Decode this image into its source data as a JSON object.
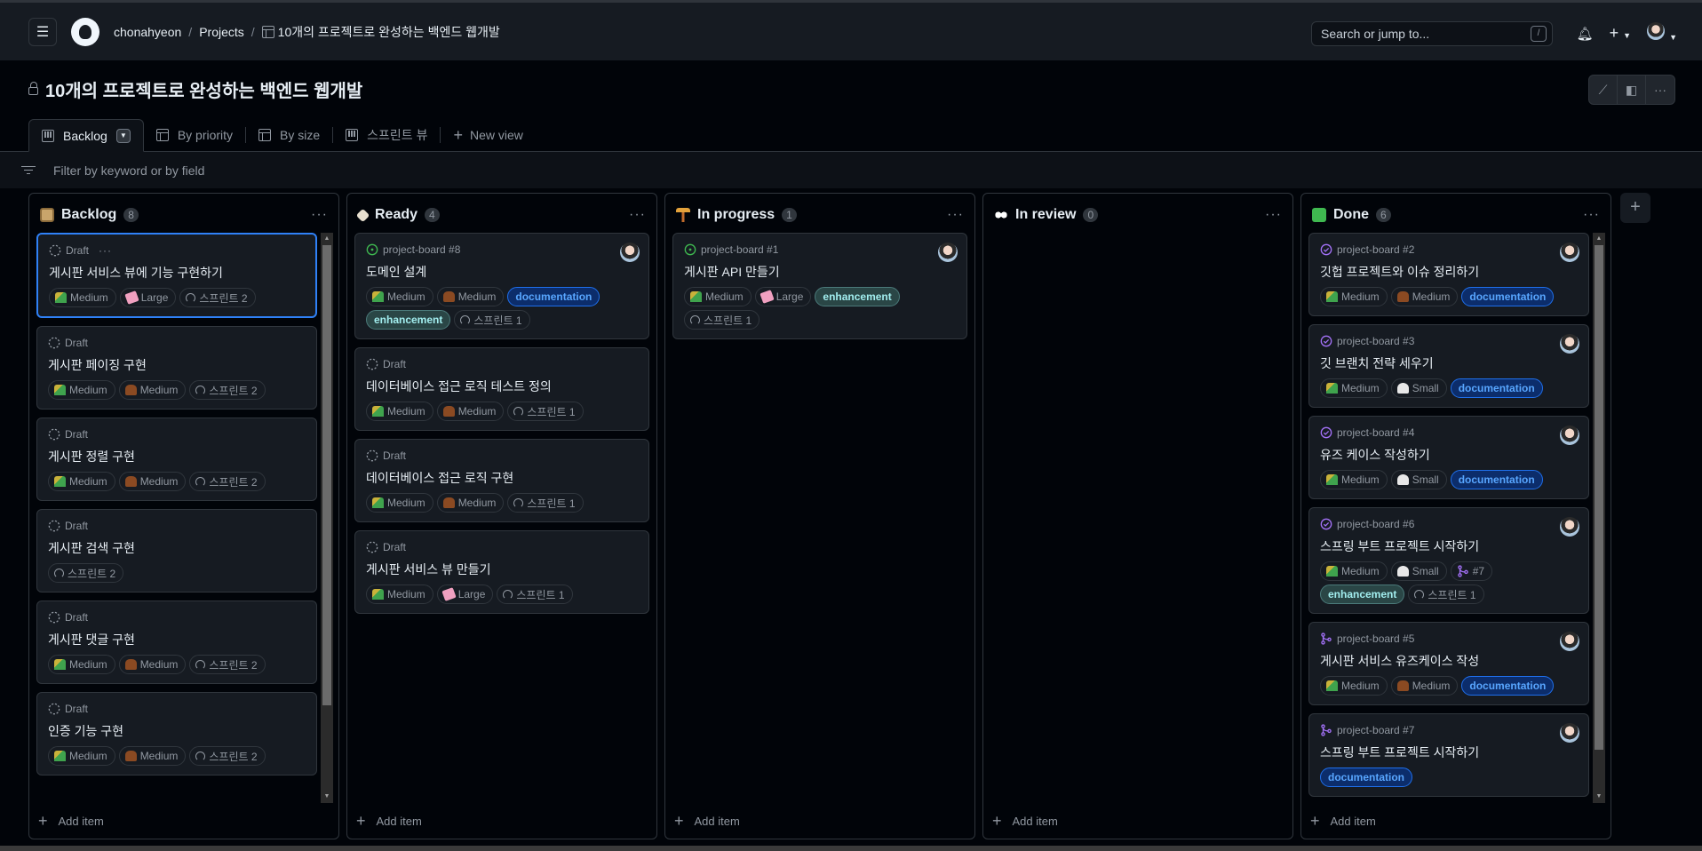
{
  "header": {
    "user": "chonahyeon",
    "projects_link": "Projects",
    "project_name": "10개의 프로젝트로 완성하는 백엔드 웹개발",
    "search_placeholder": "Search or jump to...",
    "search_shortcut": "/"
  },
  "page": {
    "title": "10개의 프로젝트로 완성하는 백엔드 웹개발",
    "visibility_icon": "lock-icon"
  },
  "views": [
    {
      "label": "Backlog",
      "icon": "board",
      "active": true
    },
    {
      "label": "By priority",
      "icon": "table",
      "active": false
    },
    {
      "label": "By size",
      "icon": "table",
      "active": false
    },
    {
      "label": "스프린트 뷰",
      "icon": "board",
      "active": false
    }
  ],
  "new_view_label": "New view",
  "filter_placeholder": "Filter by keyword or by field",
  "add_item_label": "Add item",
  "colors": {
    "accent": "#2f81f7",
    "open": "#3fb950",
    "done": "#a371f7"
  },
  "columns": [
    {
      "name": "Backlog",
      "count": "8",
      "icon": "clipboard",
      "scroll": true,
      "cards": [
        {
          "status": "draft",
          "ref": "Draft",
          "selected": true,
          "title": "게시판 서비스 뷰에 기능 구현하기",
          "chips": [
            {
              "type": "priority",
              "text": "Medium"
            },
            {
              "type": "size-large",
              "text": "Large"
            },
            {
              "type": "iteration",
              "text": "스프린트 2"
            }
          ]
        },
        {
          "status": "draft",
          "ref": "Draft",
          "title": "게시판 페이징 구현",
          "chips": [
            {
              "type": "priority",
              "text": "Medium"
            },
            {
              "type": "size-medium",
              "text": "Medium"
            },
            {
              "type": "iteration",
              "text": "스프린트 2"
            }
          ]
        },
        {
          "status": "draft",
          "ref": "Draft",
          "title": "게시판 정렬 구현",
          "chips": [
            {
              "type": "priority",
              "text": "Medium"
            },
            {
              "type": "size-medium",
              "text": "Medium"
            },
            {
              "type": "iteration",
              "text": "스프린트 2"
            }
          ]
        },
        {
          "status": "draft",
          "ref": "Draft",
          "title": "게시판 검색 구현",
          "chips": [
            {
              "type": "iteration",
              "text": "스프린트 2"
            }
          ]
        },
        {
          "status": "draft",
          "ref": "Draft",
          "title": "게시판 댓글 구현",
          "chips": [
            {
              "type": "priority",
              "text": "Medium"
            },
            {
              "type": "size-medium",
              "text": "Medium"
            },
            {
              "type": "iteration",
              "text": "스프린트 2"
            }
          ]
        },
        {
          "status": "draft",
          "ref": "Draft",
          "title": "인증 기능 구현",
          "chips": [
            {
              "type": "priority",
              "text": "Medium"
            },
            {
              "type": "size-medium",
              "text": "Medium"
            },
            {
              "type": "iteration",
              "text": "스프린트 2"
            }
          ]
        }
      ]
    },
    {
      "name": "Ready",
      "count": "4",
      "icon": "tag",
      "cards": [
        {
          "status": "open",
          "ref": "project-board #8",
          "avatar": true,
          "title": "도메인 설계",
          "chips": [
            {
              "type": "priority",
              "text": "Medium"
            },
            {
              "type": "size-medium",
              "text": "Medium"
            },
            {
              "type": "documentation",
              "text": "documentation"
            },
            {
              "type": "enhancement",
              "text": "enhancement"
            },
            {
              "type": "iteration",
              "text": "스프린트 1"
            }
          ]
        },
        {
          "status": "draft",
          "ref": "Draft",
          "title": "데이터베이스 접근 로직 테스트 정의",
          "chips": [
            {
              "type": "priority",
              "text": "Medium"
            },
            {
              "type": "size-medium",
              "text": "Medium"
            },
            {
              "type": "iteration",
              "text": "스프린트 1"
            }
          ]
        },
        {
          "status": "draft",
          "ref": "Draft",
          "title": "데이터베이스 접근 로직 구현",
          "chips": [
            {
              "type": "priority",
              "text": "Medium"
            },
            {
              "type": "size-medium",
              "text": "Medium"
            },
            {
              "type": "iteration",
              "text": "스프린트 1"
            }
          ]
        },
        {
          "status": "draft",
          "ref": "Draft",
          "title": "게시판 서비스 뷰 만들기",
          "chips": [
            {
              "type": "priority",
              "text": "Medium"
            },
            {
              "type": "size-large",
              "text": "Large"
            },
            {
              "type": "iteration",
              "text": "스프린트 1"
            }
          ]
        }
      ]
    },
    {
      "name": "In progress",
      "count": "1",
      "icon": "crane",
      "cards": [
        {
          "status": "open",
          "ref": "project-board #1",
          "avatar": true,
          "title": "게시판 API 만들기",
          "chips": [
            {
              "type": "priority",
              "text": "Medium"
            },
            {
              "type": "size-large",
              "text": "Large"
            },
            {
              "type": "enhancement",
              "text": "enhancement"
            },
            {
              "type": "iteration",
              "text": "스프린트 1"
            }
          ]
        }
      ]
    },
    {
      "name": "In review",
      "count": "0",
      "icon": "eyes",
      "cards": []
    },
    {
      "name": "Done",
      "count": "6",
      "icon": "check",
      "scroll": true,
      "cards": [
        {
          "status": "closed",
          "ref": "project-board #2",
          "avatar": true,
          "title": "깃헙 프로젝트와 이슈 정리하기",
          "chips": [
            {
              "type": "priority",
              "text": "Medium"
            },
            {
              "type": "size-medium",
              "text": "Medium"
            },
            {
              "type": "documentation",
              "text": "documentation"
            }
          ]
        },
        {
          "status": "closed",
          "ref": "project-board #3",
          "avatar": true,
          "title": "깃 브랜치 전략 세우기",
          "chips": [
            {
              "type": "priority",
              "text": "Medium"
            },
            {
              "type": "size-small",
              "text": "Small"
            },
            {
              "type": "documentation",
              "text": "documentation"
            }
          ]
        },
        {
          "status": "closed",
          "ref": "project-board #4",
          "avatar": true,
          "title": "유즈 케이스 작성하기",
          "chips": [
            {
              "type": "priority",
              "text": "Medium"
            },
            {
              "type": "size-small",
              "text": "Small"
            },
            {
              "type": "documentation",
              "text": "documentation"
            }
          ]
        },
        {
          "status": "closed",
          "ref": "project-board #6",
          "avatar": true,
          "title": "스프링 부트 프로젝트 시작하기",
          "chips": [
            {
              "type": "priority",
              "text": "Medium"
            },
            {
              "type": "size-small",
              "text": "Small"
            },
            {
              "type": "pr",
              "text": "#7"
            },
            {
              "type": "enhancement",
              "text": "enhancement"
            },
            {
              "type": "iteration",
              "text": "스프린트 1"
            }
          ]
        },
        {
          "status": "merged",
          "ref": "project-board #5",
          "avatar": true,
          "title": "게시판 서비스 유즈케이스 작성",
          "chips": [
            {
              "type": "priority",
              "text": "Medium"
            },
            {
              "type": "size-medium",
              "text": "Medium"
            },
            {
              "type": "documentation",
              "text": "documentation"
            }
          ]
        },
        {
          "status": "merged",
          "ref": "project-board #7",
          "avatar": true,
          "title": "스프링 부트 프로젝트 시작하기",
          "chips": [
            {
              "type": "documentation",
              "text": "documentation"
            }
          ]
        }
      ]
    }
  ]
}
